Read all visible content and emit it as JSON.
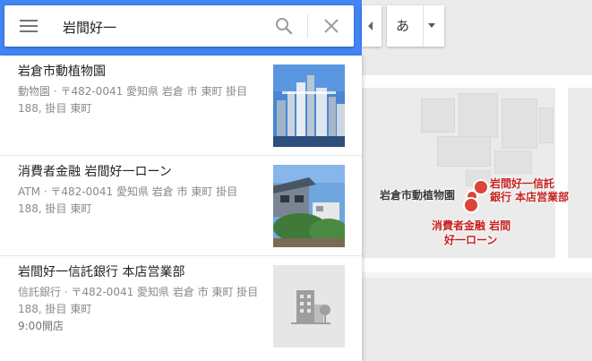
{
  "search": {
    "query": "岩間好一",
    "collapse_label": "",
    "ime_char": "あ"
  },
  "results": [
    {
      "title": "岩倉市動植物園",
      "description": "動物園 · 〒482-0041 愛知県 岩倉 市 東町 掛目 188, 掛目 東町",
      "extra": "",
      "thumb": "city-photo"
    },
    {
      "title": "消費者金融 岩間好一ローン",
      "description": "ATM · 〒482-0041 愛知県 岩倉 市 東町 掛目 188, 掛目 東町",
      "extra": "",
      "thumb": "house-photo"
    },
    {
      "title": "岩間好一信託銀行 本店営業部",
      "description": "信託銀行 · 〒482-0041 愛知県 岩倉 市 東町 掛目 188, 掛目 東町",
      "extra": "9:00開店",
      "thumb": "building-placeholder"
    }
  ],
  "map": {
    "label_zoo": "岩倉市動植物園",
    "label_bank_line1": "岩間好一信託",
    "label_bank_line2": "銀行 本店営業部",
    "label_atm_line1": "消費者金融 岩間",
    "label_atm_line2": "好一ローン"
  },
  "colors": {
    "header_blue": "#4285f4",
    "pin_red": "#db4437",
    "label_red": "#c5221f"
  }
}
